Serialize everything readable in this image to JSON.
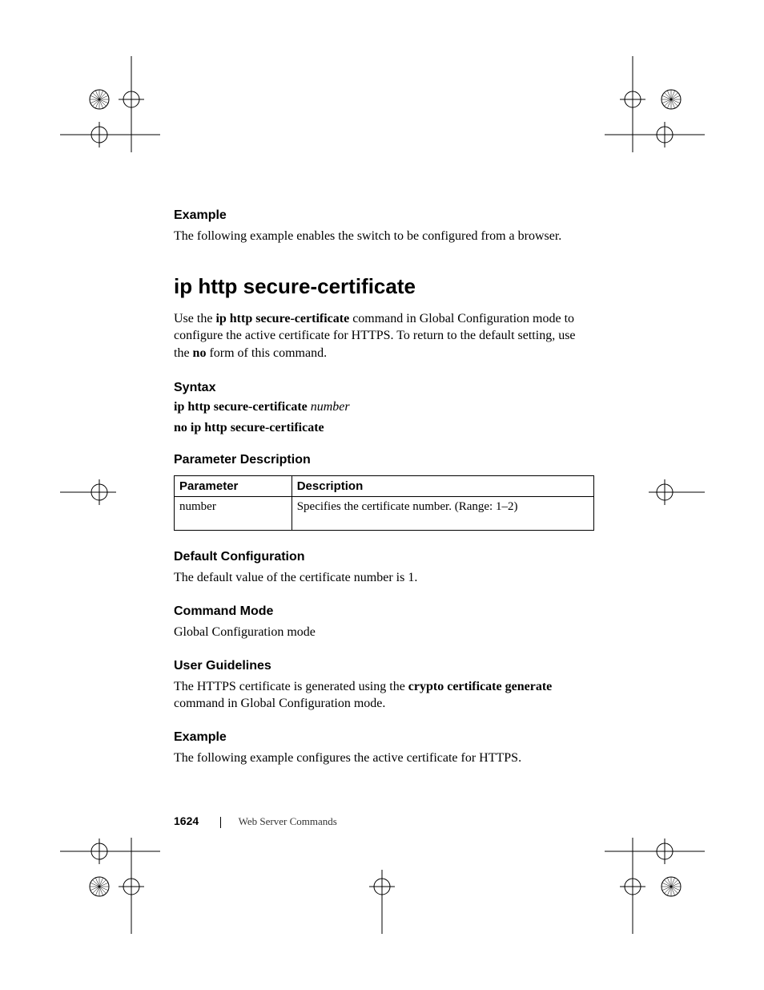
{
  "example1": {
    "heading": "Example",
    "text": "The following example enables the switch to be configured from a browser."
  },
  "title": "ip http secure-certificate",
  "intro": {
    "prefix": "Use the ",
    "cmd": "ip http secure-certificate",
    "mid": " command in Global Configuration mode to configure the active certificate for HTTPS. To return to the default setting, use the ",
    "no": "no",
    "suffix": " form of this command."
  },
  "syntax": {
    "heading": "Syntax",
    "line1_cmd": "ip http secure-certificate ",
    "line1_arg": "number",
    "line2": "no ip http secure-certificate"
  },
  "paramdesc": {
    "heading": "Parameter Description",
    "col1": "Parameter",
    "col2": "Description",
    "row1_param": "number",
    "row1_desc": "Specifies the certificate number. (Range: 1–2)"
  },
  "defaultcfg": {
    "heading": "Default Configuration",
    "text": "The default value of the certificate number is 1."
  },
  "cmdmode": {
    "heading": "Command Mode",
    "text": "Global Configuration mode"
  },
  "guidelines": {
    "heading": "User Guidelines",
    "prefix": "The HTTPS certificate is generated using the ",
    "cmd": "crypto certificate generate",
    "suffix": " command in Global Configuration mode."
  },
  "example2": {
    "heading": "Example",
    "text": "The following example configures the active certificate for HTTPS."
  },
  "footer": {
    "page": "1624",
    "chapter": "Web Server Commands"
  }
}
